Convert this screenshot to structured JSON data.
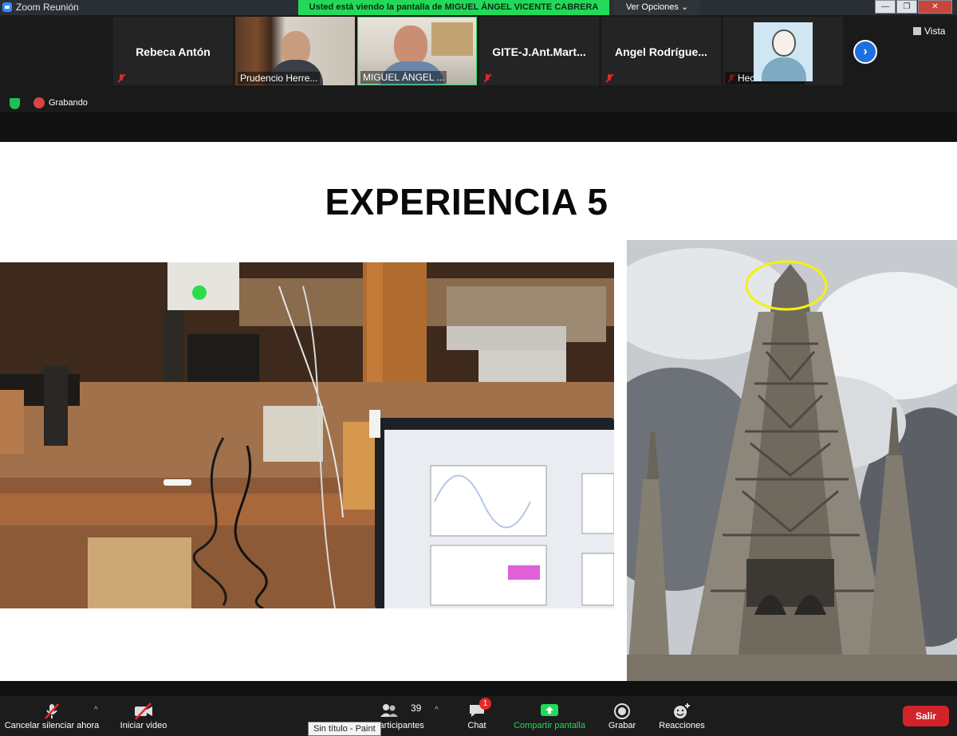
{
  "window": {
    "title": "Zoom Reunión"
  },
  "banner": {
    "text": "Usted está viendo la pantalla de MIGUEL ÁNGEL VICENTE CABRERA",
    "view_options": "Ver Opciones ⌄"
  },
  "participants": [
    {
      "name": "Rebeca Antón",
      "muted": true,
      "video": false
    },
    {
      "name": "Prudencio Herre...",
      "muted": false,
      "video": true
    },
    {
      "name": "MIGUEL ÁNGEL ...",
      "muted": false,
      "video": true,
      "active_speaker": true
    },
    {
      "name": "GITE-J.Ant.Mart...",
      "muted": true,
      "video": false
    },
    {
      "name": "Angel  Rodrígue...",
      "muted": true,
      "video": false
    },
    {
      "name": "Hector Ramo...",
      "muted": true,
      "video": false,
      "avatar": true
    }
  ],
  "view_button": "Vista",
  "status": {
    "recording_label": "Grabando"
  },
  "slide": {
    "title": "EXPERIENCIA 5"
  },
  "toolbar": {
    "mute_label": "Cancelar silenciar ahora",
    "video_label": "Iniciar video",
    "participants_count": "39",
    "participants_label": "Participantes",
    "chat_label": "Chat",
    "chat_badge": "1",
    "share_label": "Compartir pantalla",
    "record_label": "Grabar",
    "reactions_label": "Reacciones",
    "exit_label": "Salir"
  },
  "taskbar_tooltip": "Sin título - Paint",
  "colors": {
    "share_green": "#23d959",
    "exit_red": "#d1242a",
    "accent_blue": "#1e6fe0"
  }
}
